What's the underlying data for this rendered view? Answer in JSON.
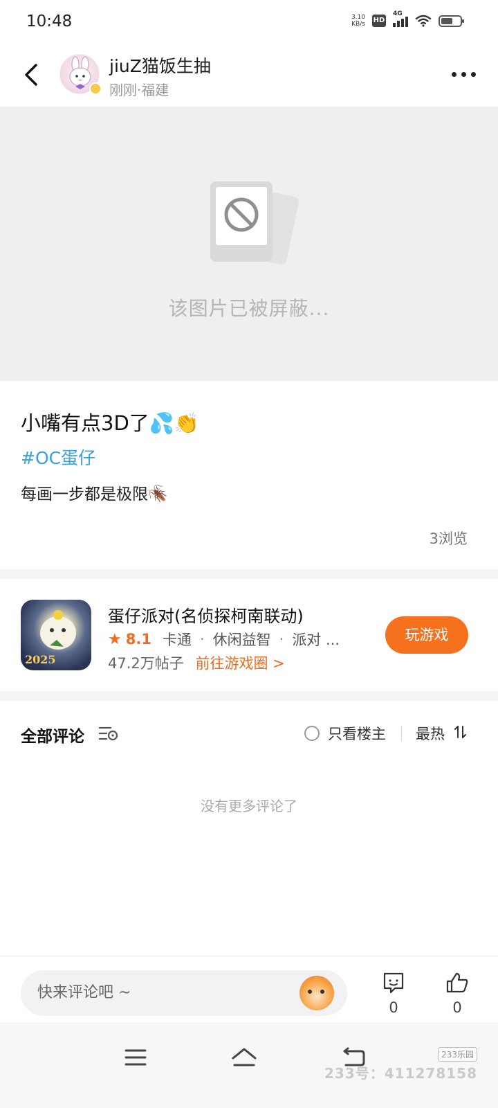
{
  "status_bar": {
    "time": "10:48",
    "net_speed_value": "3.10",
    "net_speed_unit": "KB/s",
    "hd": "HD",
    "network": "4G"
  },
  "header": {
    "user_name": "jiuZ猫饭生抽",
    "user_meta": "刚刚·福建"
  },
  "blocked_image": {
    "text": "该图片已被屏蔽..."
  },
  "post": {
    "title": "小嘴有点3D了💦👏",
    "tag": "#OC蛋仔",
    "body": "每画一步都是极限🪳",
    "views": "3浏览"
  },
  "game_card": {
    "title": "蛋仔派对(名侦探柯南联动)",
    "rating": "8.1",
    "tags": [
      "卡通",
      "休闲益智",
      "派对 ..."
    ],
    "posts": "47.2万帖子",
    "circle_link": "前往游戏圈 >",
    "play_button": "玩游戏",
    "icon_year": "2025"
  },
  "comments": {
    "title": "全部评论",
    "owner_only": "只看楼主",
    "sort": "最热",
    "empty_text": "没有更多评论了"
  },
  "bottom_bar": {
    "input_placeholder": "快来评论吧 ~",
    "comment_count": "0",
    "like_count": "0"
  },
  "watermark": {
    "badge": "233乐园",
    "text": "233号：411278158"
  },
  "colors": {
    "accent": "#f6711d",
    "tag_blue": "#3aa0e0",
    "page_bg": "#f5f5f7"
  }
}
